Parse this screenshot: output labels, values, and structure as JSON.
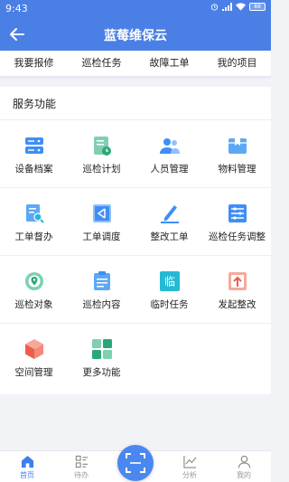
{
  "status_bar": {
    "time": "9:43",
    "battery": "88"
  },
  "header": {
    "title": "蓝莓维保云"
  },
  "quick_tabs": [
    "我要报修",
    "巡检任务",
    "故障工单",
    "我的项目"
  ],
  "section": {
    "title": "服务功能"
  },
  "functions": [
    {
      "label": "设备档案",
      "icon": "device-archive-icon"
    },
    {
      "label": "巡检计划",
      "icon": "inspection-plan-icon"
    },
    {
      "label": "人员管理",
      "icon": "personnel-icon"
    },
    {
      "label": "物料管理",
      "icon": "material-box-icon"
    },
    {
      "label": "工单督办",
      "icon": "work-order-supervise-icon"
    },
    {
      "label": "工单调度",
      "icon": "work-order-dispatch-icon"
    },
    {
      "label": "整改工单",
      "icon": "rectification-pen-icon"
    },
    {
      "label": "巡检任务调整",
      "icon": "task-adjust-icon"
    },
    {
      "label": "巡检对象",
      "icon": "inspection-target-icon"
    },
    {
      "label": "巡检内容",
      "icon": "inspection-content-icon"
    },
    {
      "label": "临时任务",
      "icon": "temporary-task-icon",
      "glyph": "临"
    },
    {
      "label": "发起整改",
      "icon": "start-rectification-icon"
    },
    {
      "label": "空间管理",
      "icon": "space-cube-icon"
    },
    {
      "label": "更多功能",
      "icon": "more-grid-icon"
    }
  ],
  "tab_bar": {
    "home": "首页",
    "todo": "待办",
    "analysis": "分析",
    "mine": "我的"
  },
  "colors": {
    "primary": "#4a7fe6",
    "active_tab": "#3d7ef2"
  }
}
